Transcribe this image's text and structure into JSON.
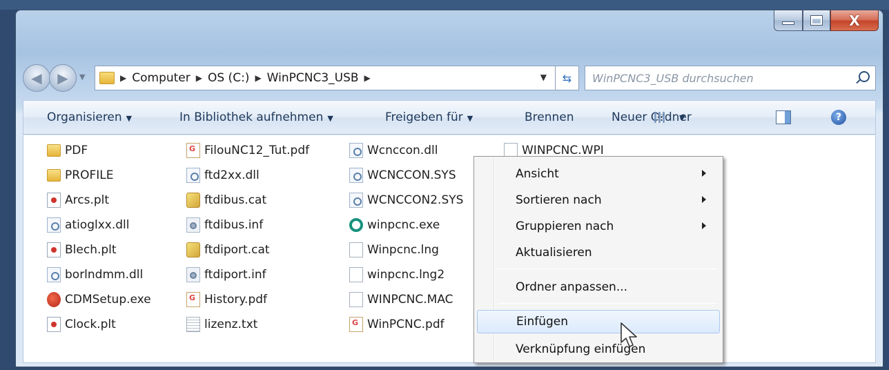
{
  "window": {
    "caption": {
      "close_glyph": "X"
    }
  },
  "nav": {
    "back_glyph": "◀",
    "forward_glyph": "▶",
    "breadcrumbs": [
      "Computer",
      "OS (C:)",
      "WinPCNC3_USB"
    ],
    "crumb_sep": "▶",
    "search_placeholder": "WinPCNC3_USB durchsuchen"
  },
  "commandbar": {
    "organize": "Organisieren",
    "library": "In Bibliothek aufnehmen",
    "share": "Freigeben für",
    "burn": "Brennen",
    "new_folder": "Neuer Ordner",
    "dropdown_arrow": "▼",
    "help_glyph": "?"
  },
  "files": {
    "col1": [
      {
        "name": "PDF",
        "icon": "folder-icon"
      },
      {
        "name": "PROFILE",
        "icon": "folder-icon"
      },
      {
        "name": "Arcs.plt",
        "icon": "plot-file-icon"
      },
      {
        "name": "atioglxx.dll",
        "icon": "dll-file-icon"
      },
      {
        "name": "Blech.plt",
        "icon": "plot-file-icon"
      },
      {
        "name": "borlndmm.dll",
        "icon": "dll-file-icon"
      },
      {
        "name": "CDMSetup.exe",
        "icon": "setup-exe-icon"
      },
      {
        "name": "Clock.plt",
        "icon": "plot-file-icon"
      }
    ],
    "col2": [
      {
        "name": "FilouNC12_Tut.pdf",
        "icon": "pdf-file-icon"
      },
      {
        "name": "ftd2xx.dll",
        "icon": "dll-file-icon"
      },
      {
        "name": "ftdibus.cat",
        "icon": "catalog-file-icon"
      },
      {
        "name": "ftdibus.inf",
        "icon": "inf-file-icon"
      },
      {
        "name": "ftdiport.cat",
        "icon": "catalog-file-icon"
      },
      {
        "name": "ftdiport.inf",
        "icon": "inf-file-icon"
      },
      {
        "name": "History.pdf",
        "icon": "pdf-file-icon"
      },
      {
        "name": "lizenz.txt",
        "icon": "text-file-icon"
      }
    ],
    "col3": [
      {
        "name": "Wcnccon.dll",
        "icon": "dll-file-icon"
      },
      {
        "name": "WCNCCON.SYS",
        "icon": "dll-file-icon"
      },
      {
        "name": "WCNCCON2.SYS",
        "icon": "dll-file-icon"
      },
      {
        "name": "winpcnc.exe",
        "icon": "winpcnc-exe-icon"
      },
      {
        "name": "Winpcnc.lng",
        "icon": "generic-file-icon"
      },
      {
        "name": "winpcnc.lng2",
        "icon": "generic-file-icon"
      },
      {
        "name": "WINPCNC.MAC",
        "icon": "generic-file-icon"
      },
      {
        "name": "WinPCNC.pdf",
        "icon": "pdf-file-icon"
      }
    ],
    "col4": [
      {
        "name": "WINPCNC.WPI",
        "icon": "generic-file-icon"
      }
    ]
  },
  "context_menu": {
    "items": [
      {
        "label": "Ansicht",
        "submenu": true
      },
      {
        "label": "Sortieren nach",
        "submenu": true
      },
      {
        "label": "Gruppieren nach",
        "submenu": true
      },
      {
        "label": "Aktualisieren",
        "submenu": false
      },
      {
        "label": "Ordner anpassen...",
        "submenu": false
      },
      {
        "label": "Einfügen",
        "submenu": false,
        "hovered": true
      },
      {
        "label": "Verknüpfung einfügen",
        "submenu": false
      }
    ]
  },
  "colors": {
    "desktop": "#2f4a6e",
    "menu_hover_border": "#a8c8ef",
    "command_text": "#1e395b"
  }
}
